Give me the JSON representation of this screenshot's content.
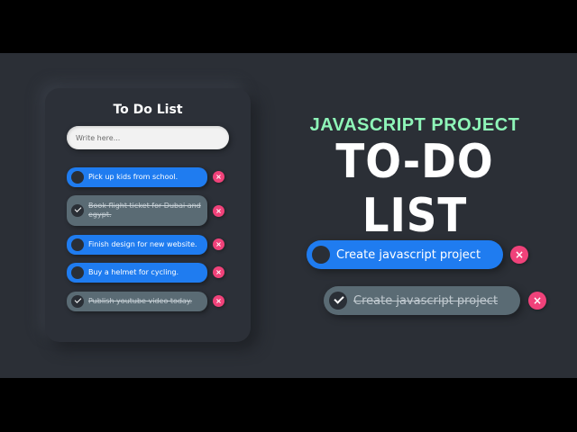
{
  "card": {
    "title": "To Do List",
    "input_placeholder": "Write here...",
    "items": [
      {
        "text": "Pick up kids from school.",
        "done": false
      },
      {
        "text": "Book flight ticket for Dubai and egypt.",
        "done": true
      },
      {
        "text": "Finish design for new website.",
        "done": false
      },
      {
        "text": "Buy a helmet for cycling.",
        "done": false
      },
      {
        "text": "Publish youtube video today.",
        "done": true
      }
    ],
    "delete_symbol": "×"
  },
  "headline": {
    "subtitle": "JAVASCRIPT PROJECT",
    "title": "TO-DO LIST"
  },
  "preview": {
    "active_item": "Create javascript project",
    "done_item": "Create javascript project",
    "delete_symbol": "×"
  },
  "colors": {
    "accent_blue": "#1f7cf0",
    "done_gray": "#5a6b74",
    "delete_pink": "#f0427a",
    "subtitle_green": "#8ef5b8",
    "background": "#2b2f36"
  }
}
